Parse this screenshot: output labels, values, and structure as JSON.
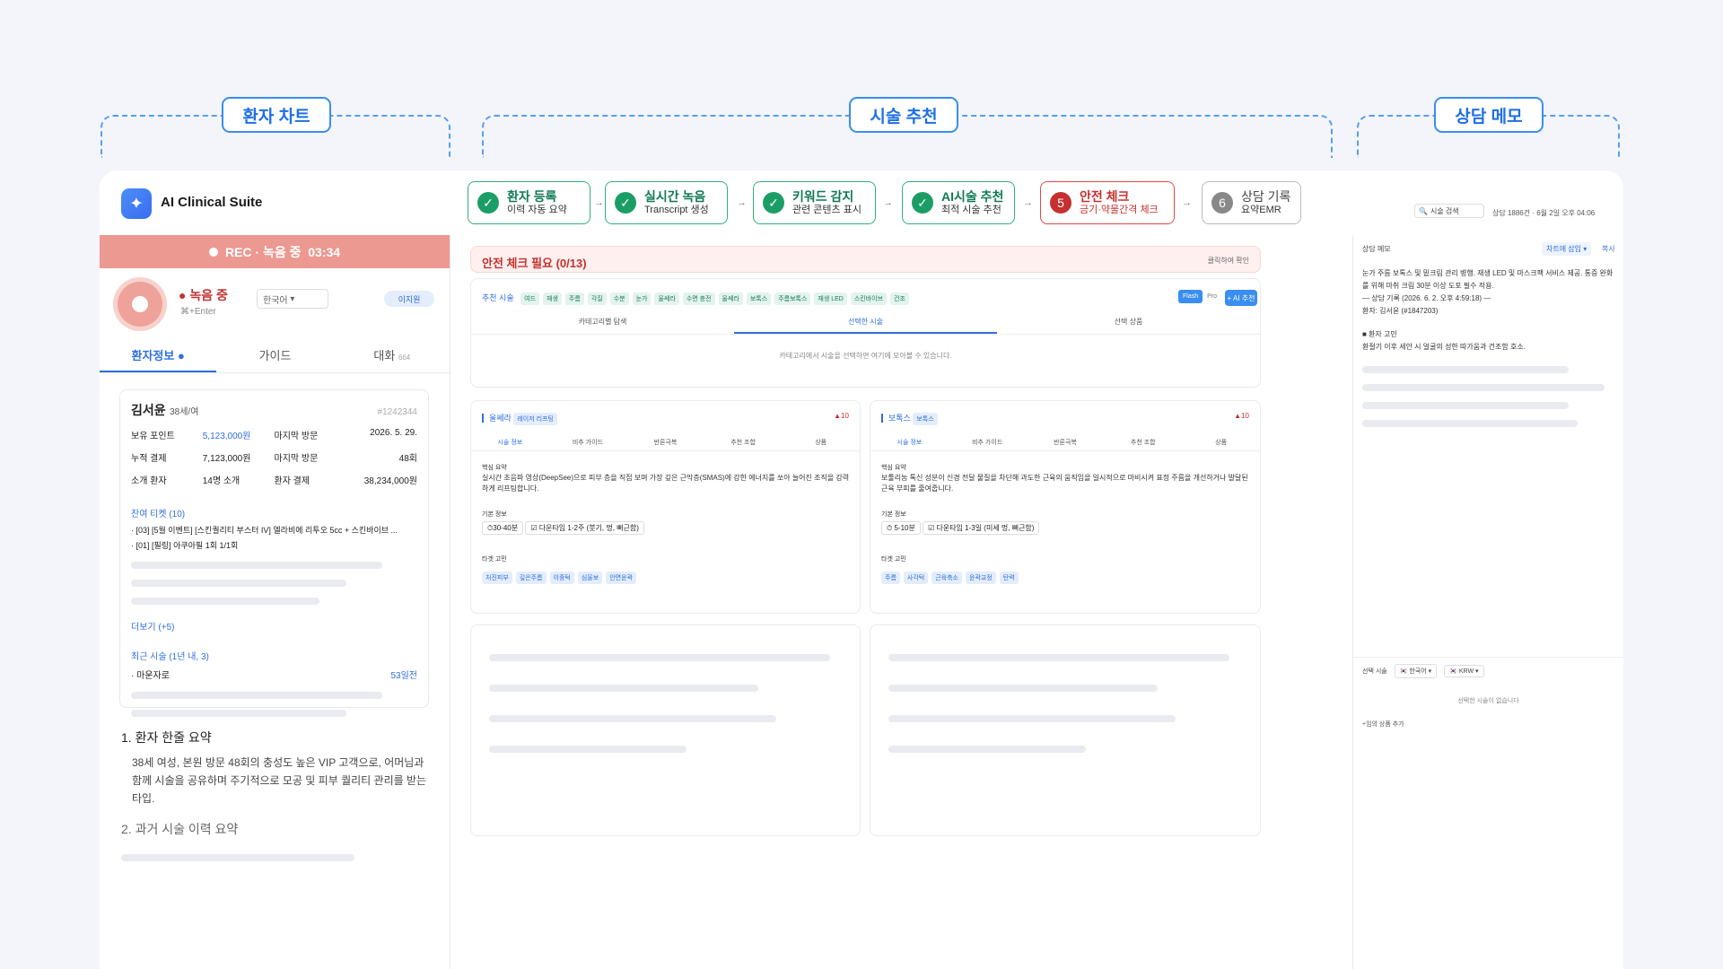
{
  "sections": {
    "patient_chart": "환자 차트",
    "procedure_rec": "시술 추천",
    "consult_memo": "상담 메모"
  },
  "app": {
    "name": "AI Clinical Suite"
  },
  "steps": [
    {
      "title": "환자 등록",
      "sub": "이력 자동 요약"
    },
    {
      "title": "실시간 녹음",
      "sub": "Transcript 생성"
    },
    {
      "title": "키워드 감지",
      "sub": "관련 콘텐츠 표시"
    },
    {
      "title": "AI시술 추천",
      "sub": "최적 시술 추천"
    },
    {
      "num": "5",
      "title": "안전 체크",
      "sub": "금기·약물간격 체크"
    },
    {
      "num": "6",
      "title": "상담 기록",
      "sub": "요약EMR"
    }
  ],
  "topright": {
    "search": "시술 검색",
    "count": "상담 1886건 · 6월 2일 오후 04:06"
  },
  "rec": {
    "label": "REC · 녹음 중",
    "time": "03:34"
  },
  "recording": {
    "status": "녹음 중",
    "shortcut": "⌘+Enter",
    "lang": "한국어",
    "doctor": "이지원"
  },
  "tabs": [
    "환자정보",
    "가이드",
    "대화"
  ],
  "tabs_count": "664",
  "patient": {
    "name": "김서윤",
    "age": "38세/여",
    "id": "#1242344",
    "rows": [
      [
        "보유 포인트",
        "5,123,000원",
        "마지막 방문",
        "2026. 5. 29."
      ],
      [
        "누적 결제",
        "7,123,000원",
        "마지막 방문",
        "48회"
      ],
      [
        "소개 환자",
        "14명 소개",
        "환자 결제",
        "38,234,000원"
      ]
    ],
    "ticket_title": "잔여 티켓 (10)",
    "tickets": [
      "· [03] [5월 이벤트] [스킨퀄리티 부스터 IV] 엘라비에 리투오 5cc + 스킨바이브 ...",
      "· [01] [필링] 아쿠아필 1회 1/1회"
    ],
    "more": "더보기 (+5)",
    "recent_title": "최근 시술 (1년 내, 3)",
    "recent_item": "· 마운자로",
    "recent_days": "53일전"
  },
  "summary": {
    "h1": "1. 환자 한줄 요약",
    "p1": "38세 여성, 본원 방문 48회의 충성도 높은 VIP 고객으로, 어머님과 함께 시술을 공유하며 주기적으로 모공 및 피부 퀄리티 관리를 받는 타입.",
    "h2": "2. 과거 시술 이력 요약"
  },
  "safety": {
    "title": "안전 체크 필요 (0/13)",
    "confirm": "클릭하여 확인"
  },
  "recommend": {
    "label": "추천 시술",
    "chips": [
      "여드",
      "재생",
      "주름",
      "각질",
      "수분",
      "눈가",
      "울쎄라",
      "수면 충전",
      "울쎄라",
      "보톡스",
      "주름보톡스",
      "재생 LED",
      "스킨바이브",
      "건조"
    ],
    "flash": "Flash",
    "pro": "Pro",
    "ai": "+ AI 추천",
    "tabs": [
      "카테고리별 탐색",
      "선택한 시술",
      "선택 상품"
    ],
    "empty": "카테고리에서 시술을 선택하면 여기에 모아볼 수 있습니다."
  },
  "cards": [
    {
      "name": "울쎄라",
      "tag": "레이저 리프팅",
      "warn": "10",
      "tabs": [
        "시술 정보",
        "비추 가이드",
        "반론극복",
        "추천 조합",
        "상품"
      ],
      "core": "핵심 요약",
      "desc": "실시간 초음파 영상(DeepSee)으로 피부 층을 직접 보며 가장 깊은 근막층(SMAS)에 강한 에너지를 쏘아 늘어진 조직을 강력하게 리프팅합니다.",
      "basic": "기본 정보",
      "time": "30-40분",
      "down": "다운타임 1-2주 (붓기, 멍, 뻐근함)",
      "target": "타겟 고민",
      "targets": [
        "처진피부",
        "깊은주름",
        "이중턱",
        "심울보",
        "안면윤곽"
      ]
    },
    {
      "name": "보톡스",
      "tag": "보톡스",
      "warn": "10",
      "tabs": [
        "시술 정보",
        "비추 가이드",
        "반론극복",
        "추천 조합",
        "상품"
      ],
      "core": "핵심 요약",
      "desc": "보툴리눔 톡신 성분이 신경 전달 물질을 차단해 과도한 근육의 움직임을 일시적으로 마비시켜 표정 주름을 개선하거나 발달된 근육 부피를 줄여줍니다.",
      "basic": "기본 정보",
      "time": "5-10분",
      "down": "다운타임 1-3일 (미세 멍, 뻐근함)",
      "target": "타겟 고민",
      "targets": [
        "주름",
        "사각턱",
        "근육축소",
        "윤곽교정",
        "탄력"
      ]
    }
  ],
  "memo": {
    "title": "상담 메모",
    "insert": "차트에 삽입 ▾",
    "copy": "복사",
    "body": "눈가 주름 보톡스 및 밑크림 관리 병행. 재생 LED 및 마스크팩 서비스 제공. 통증 완화를 위해 마취 크림 30분 이상 도포 필수 적용.",
    "record": "— 상담 기록 (2026. 6. 2. 오후 4:59:18) —",
    "patient": "환자: 김서윤 (#1847203)",
    "concern_title": "■ 환자 고민",
    "concern": "환절기 이후 세안 시 얼굴의 성한 따가움과 건조함 호소."
  },
  "selected": {
    "label": "선택 시술",
    "lang": "한국어 ▾",
    "currency": "KRW ▾",
    "empty": "선택한 시술이 없습니다",
    "add": "+임의 상품 추가"
  }
}
